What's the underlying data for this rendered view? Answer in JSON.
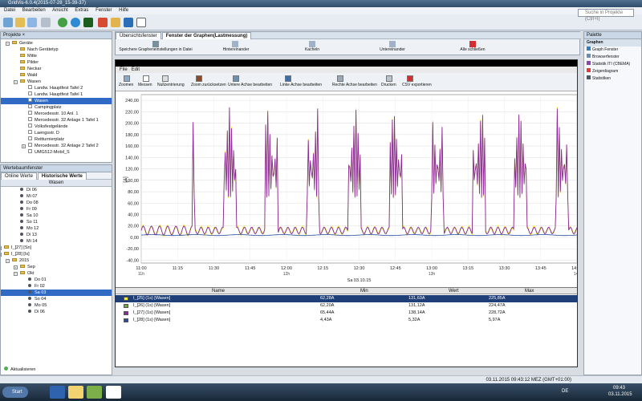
{
  "app": {
    "title": "GridVis-6.0.4(2015-07-28_15-39-37)"
  },
  "menu": [
    "Datei",
    "Bearbeiten",
    "Ansicht",
    "Extras",
    "Fenster",
    "Hilfe"
  ],
  "search": {
    "placeholder": "Suche in Projekte (Ctrl+I)"
  },
  "projects": {
    "panel_title": "Projekte",
    "items": [
      {
        "label": "Geräte",
        "level": 1,
        "type": "folder",
        "expanded": true
      },
      {
        "label": "Nach Gerätetyp",
        "level": 2,
        "type": "folder",
        "expanded": false
      },
      {
        "label": "Mitte",
        "level": 2,
        "type": "folder",
        "expanded": false
      },
      {
        "label": "Pilder",
        "level": 2,
        "type": "folder",
        "expanded": false
      },
      {
        "label": "Neckar",
        "level": 2,
        "type": "folder",
        "expanded": false
      },
      {
        "label": "Wald",
        "level": 2,
        "type": "folder",
        "expanded": false
      },
      {
        "label": "Wasen",
        "level": 2,
        "type": "folder",
        "expanded": true
      },
      {
        "label": "Landw. Hauptfest Tafel 2",
        "level": 3,
        "type": "file"
      },
      {
        "label": "Landw. Hauptfest Tafel 1",
        "level": 3,
        "type": "file"
      },
      {
        "label": "Wasen",
        "level": 3,
        "type": "file",
        "selected": true
      },
      {
        "label": "Campingplatz",
        "level": 3,
        "type": "file"
      },
      {
        "label": "Mercedesstr. 10 Anl. 1",
        "level": 3,
        "type": "file"
      },
      {
        "label": "Mercedesstr. 32 Anlage 1 Tafel 1",
        "level": 3,
        "type": "file"
      },
      {
        "label": "Volksfestgelände",
        "level": 3,
        "type": "file"
      },
      {
        "label": "Laengsstr. D",
        "level": 3,
        "type": "file"
      },
      {
        "label": "Reitturnierplatz",
        "level": 3,
        "type": "file"
      },
      {
        "label": "Mercedesstr. 32 Anlage 2 Tafel 2",
        "level": 3,
        "type": "file",
        "expandable": true
      },
      {
        "label": "UMG512-Mobil_S",
        "level": 3,
        "type": "file"
      }
    ]
  },
  "values_panel": {
    "title": "Wertebaumfenster",
    "tabs": [
      "Online Werte",
      "Historische Werte"
    ],
    "header": "Wasen",
    "items": [
      {
        "label": "Di 06",
        "level": 2,
        "kind": "dot"
      },
      {
        "label": "Mi 07",
        "level": 2,
        "kind": "dot"
      },
      {
        "label": "Do 08",
        "level": 2,
        "kind": "dot"
      },
      {
        "label": "Fr 09",
        "level": 2,
        "kind": "dot"
      },
      {
        "label": "Sa 10",
        "level": 2,
        "kind": "dot"
      },
      {
        "label": "So 11",
        "level": 2,
        "kind": "dot"
      },
      {
        "label": "Mo 12",
        "level": 2,
        "kind": "dot"
      },
      {
        "label": "Di 13",
        "level": 2,
        "kind": "dot"
      },
      {
        "label": "Mi 14",
        "level": 2,
        "kind": "dot"
      },
      {
        "label": "I_[27] [Sn]",
        "level": 0,
        "kind": "folder",
        "expandable": true
      },
      {
        "label": "I_[28] [Is]",
        "level": 0,
        "kind": "folder",
        "expanded": true
      },
      {
        "label": "2015",
        "level": 1,
        "kind": "folder",
        "expanded": true
      },
      {
        "label": "Sep",
        "level": 2,
        "kind": "folder",
        "expandable": true
      },
      {
        "label": "Okt",
        "level": 2,
        "kind": "folder",
        "expanded": true
      },
      {
        "label": "Do 01",
        "level": 3,
        "kind": "dot"
      },
      {
        "label": "Fr 02",
        "level": 3,
        "kind": "dot"
      },
      {
        "label": "Sa 03",
        "level": 3,
        "kind": "dot",
        "selected": true
      },
      {
        "label": "So 04",
        "level": 3,
        "kind": "dot"
      },
      {
        "label": "Mo 05",
        "level": 3,
        "kind": "dot"
      },
      {
        "label": "Di 06",
        "level": 3,
        "kind": "dot"
      }
    ],
    "refresh_label": "Aktualisieren"
  },
  "editor_tabs": [
    "Übersichtsfenster",
    "Fenster der Graphen(Lastmessung)"
  ],
  "top_actions": [
    "Speichere Grapheneinstellungen in Datei",
    "Hintereinander",
    "Kacheln",
    "Untereinander",
    "Alle schließen"
  ],
  "graph_window": {
    "menu": [
      "File",
      "Edit"
    ],
    "tools": [
      "Zoomen",
      "Messen",
      "Nullzentrierung",
      "Zoom zurücksetzen",
      "Untere Achse bearbeiten",
      "Linke Achse bearbeiten",
      "Rechte Achse bearbeiten",
      "Drucken",
      "CSV exportieren"
    ]
  },
  "chart_data": {
    "type": "line",
    "ylabel": "[A]",
    "yticks": [
      -40,
      -20,
      0,
      20,
      40,
      60,
      80,
      100,
      120,
      140,
      160,
      180,
      200,
      220,
      240
    ],
    "yticklabels": [
      "-40,00",
      "-20,00",
      "0,00",
      "20,00",
      "40,00",
      "60,00",
      "80,00",
      "100,00",
      "120,00",
      "140,00",
      "160,00",
      "180,00",
      "200,00",
      "220,00",
      "240,00"
    ],
    "xticks": [
      "11:00",
      "11:15",
      "11:30",
      "11:45",
      "12:00",
      "12:15",
      "12:30",
      "12:45",
      "13:00",
      "13:15",
      "13:30",
      "13:45",
      "14:00"
    ],
    "xgroup": [
      "11h",
      "12h",
      "13h",
      "14h"
    ],
    "xdate": "Sa 03.10.15",
    "ylim": [
      -45,
      250
    ],
    "series": [
      {
        "name": "I_[25] (1s) [Wasen]",
        "color": "#f4ef2d",
        "min": "62,28A",
        "value": "131,63A",
        "max": "225,85A"
      },
      {
        "name": "I_[26] (1s) [Wasen]",
        "color": "#72a63f",
        "min": "62,20A",
        "value": "131,12A",
        "max": "224,47A"
      },
      {
        "name": "I_[27] (1s) [Wasen]",
        "color": "#8c2a9b",
        "min": "65,44A",
        "value": "138,14A",
        "max": "228,72A"
      },
      {
        "name": "I_[28] (1s) [Wasen]",
        "color": "#264c9e",
        "min": "4,43A",
        "value": "5,32A",
        "max": "5,97A"
      }
    ]
  },
  "legend_headers": [
    "Name",
    "Min",
    "Wert",
    "Max"
  ],
  "palette": {
    "title": "Palette",
    "items": [
      "Graphen",
      "Graph Fenster",
      "Browserfenster",
      "Statistik ITI (CBEMA)",
      "Zeigerdiagram",
      "Statistiken"
    ]
  },
  "status": {
    "time": "03.11.2015 09:43:12 MEZ (GMT+01:00)",
    "clock": "09:43",
    "date": "03.11.2015",
    "lang": "DE"
  },
  "taskbar": {
    "start": "Start"
  }
}
